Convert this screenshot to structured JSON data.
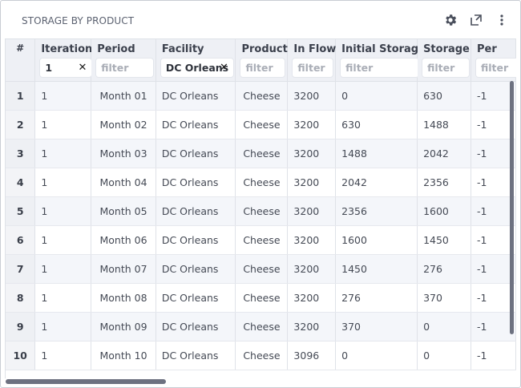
{
  "panel": {
    "title": "STORAGE BY PRODUCT"
  },
  "icons": {
    "settings": "gear-icon",
    "expand": "expand-icon",
    "more": "more-vertical-icon"
  },
  "columns": [
    {
      "key": "idx",
      "label": "#"
    },
    {
      "key": "iteration",
      "label": "Iteration",
      "filter_value": "1",
      "filter_placeholder": ""
    },
    {
      "key": "period",
      "label": "Period",
      "filter_value": "",
      "filter_placeholder": "filter"
    },
    {
      "key": "facility",
      "label": "Facility",
      "filter_value": "DC Orleans",
      "filter_placeholder": ""
    },
    {
      "key": "product",
      "label": "Product",
      "filter_value": "",
      "filter_placeholder": "filter"
    },
    {
      "key": "in_flow",
      "label": "In Flow",
      "filter_value": "",
      "filter_placeholder": "filter"
    },
    {
      "key": "initial_storage",
      "label": "Initial Storage",
      "filter_value": "",
      "filter_placeholder": "filter"
    },
    {
      "key": "storage",
      "label": "Storage",
      "filter_value": "",
      "filter_placeholder": "filter"
    },
    {
      "key": "per",
      "label": "Per",
      "filter_value": "",
      "filter_placeholder": "filter"
    }
  ],
  "rows": [
    {
      "idx": "1",
      "iteration": "1",
      "period": "Month 01",
      "facility": "DC Orleans",
      "product": "Cheese",
      "in_flow": "3200",
      "initial_storage": "0",
      "storage": "630",
      "per": "-1"
    },
    {
      "idx": "2",
      "iteration": "1",
      "period": "Month 02",
      "facility": "DC Orleans",
      "product": "Cheese",
      "in_flow": "3200",
      "initial_storage": "630",
      "storage": "1488",
      "per": "-1"
    },
    {
      "idx": "3",
      "iteration": "1",
      "period": "Month 03",
      "facility": "DC Orleans",
      "product": "Cheese",
      "in_flow": "3200",
      "initial_storage": "1488",
      "storage": "2042",
      "per": "-1"
    },
    {
      "idx": "4",
      "iteration": "1",
      "period": "Month 04",
      "facility": "DC Orleans",
      "product": "Cheese",
      "in_flow": "3200",
      "initial_storage": "2042",
      "storage": "2356",
      "per": "-1"
    },
    {
      "idx": "5",
      "iteration": "1",
      "period": "Month 05",
      "facility": "DC Orleans",
      "product": "Cheese",
      "in_flow": "3200",
      "initial_storage": "2356",
      "storage": "1600",
      "per": "-1"
    },
    {
      "idx": "6",
      "iteration": "1",
      "period": "Month 06",
      "facility": "DC Orleans",
      "product": "Cheese",
      "in_flow": "3200",
      "initial_storage": "1600",
      "storage": "1450",
      "per": "-1"
    },
    {
      "idx": "7",
      "iteration": "1",
      "period": "Month 07",
      "facility": "DC Orleans",
      "product": "Cheese",
      "in_flow": "3200",
      "initial_storage": "1450",
      "storage": "276",
      "per": "-1"
    },
    {
      "idx": "8",
      "iteration": "1",
      "period": "Month 08",
      "facility": "DC Orleans",
      "product": "Cheese",
      "in_flow": "3200",
      "initial_storage": "276",
      "storage": "370",
      "per": "-1"
    },
    {
      "idx": "9",
      "iteration": "1",
      "period": "Month 09",
      "facility": "DC Orleans",
      "product": "Cheese",
      "in_flow": "3200",
      "initial_storage": "370",
      "storage": "0",
      "per": "-1"
    },
    {
      "idx": "10",
      "iteration": "1",
      "period": "Month 10",
      "facility": "DC Orleans",
      "product": "Cheese",
      "in_flow": "3096",
      "initial_storage": "0",
      "storage": "0",
      "per": "-1"
    }
  ],
  "colors": {
    "header_bg": "#eef0f5",
    "row_alt_bg": "#f4f6fa",
    "scrollbar": "#6d7180",
    "border": "#dfe2e8"
  }
}
